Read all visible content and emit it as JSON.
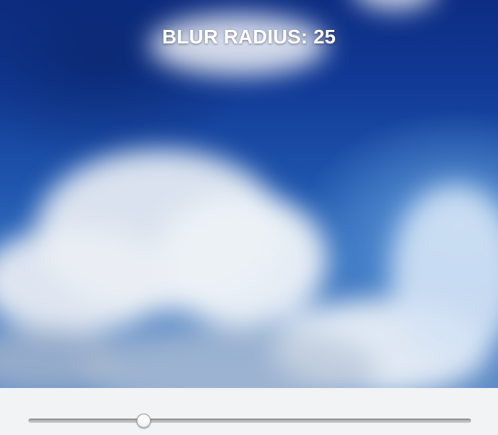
{
  "header": {
    "label": "BLUR RADIUS:",
    "value": "25"
  },
  "slider": {
    "value_fraction": 0.259
  },
  "colors": {
    "sky_top": "#0d2d83",
    "sky_bottom": "#5f8cc6",
    "cloud": "#eef3f8",
    "panel": "#f2f3f5",
    "label_text": "#ffffff"
  },
  "icons": {
    "slider_thumb": "round-slider-thumb"
  }
}
